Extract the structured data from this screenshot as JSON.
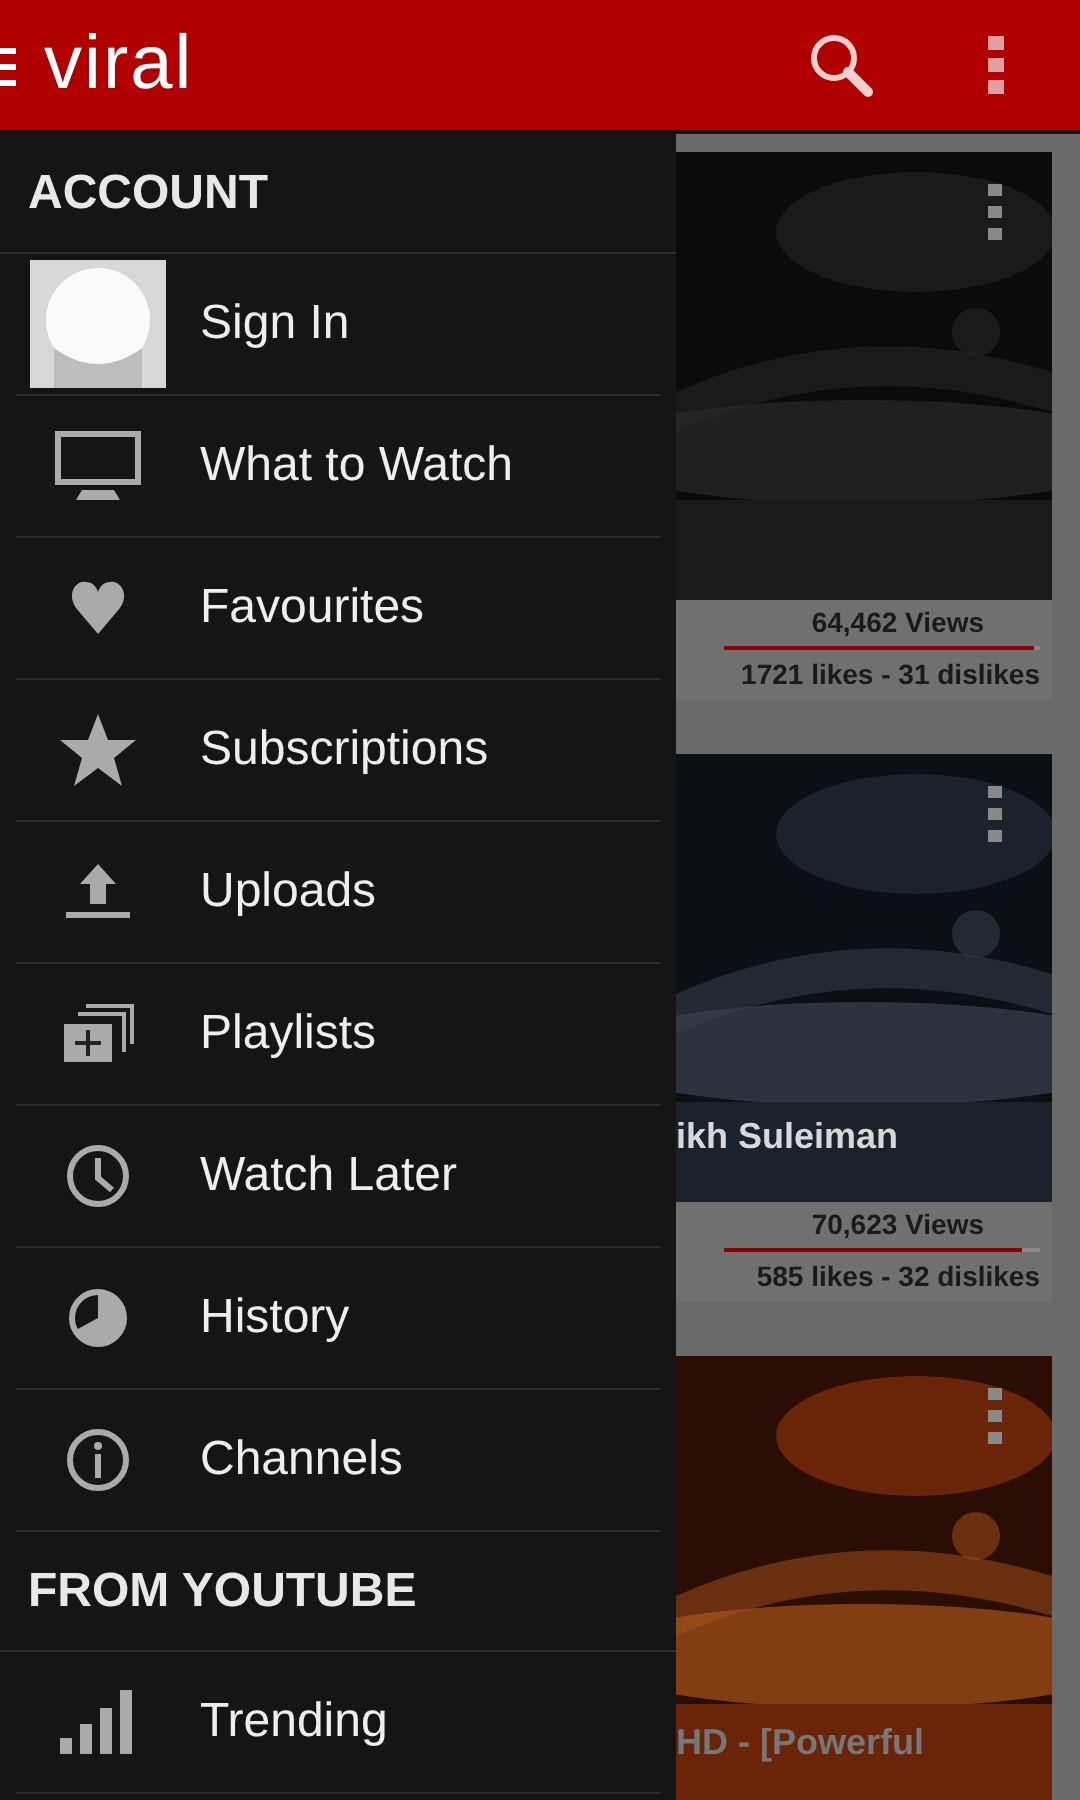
{
  "app_bar": {
    "title": "viral"
  },
  "drawer": {
    "sections": [
      {
        "heading": "ACCOUNT",
        "items": [
          {
            "label": "Sign In",
            "kind": "avatar"
          },
          {
            "label": "What to Watch",
            "kind": "monitor"
          },
          {
            "label": "Favourites",
            "kind": "heart"
          },
          {
            "label": "Subscriptions",
            "kind": "star"
          },
          {
            "label": "Uploads",
            "kind": "upload"
          },
          {
            "label": "Playlists",
            "kind": "playlists"
          },
          {
            "label": "Watch Later",
            "kind": "clock"
          },
          {
            "label": "History",
            "kind": "history"
          },
          {
            "label": "Channels",
            "kind": "info"
          }
        ]
      },
      {
        "heading": "FROM YOUTUBE",
        "items": [
          {
            "label": "Trending",
            "kind": "bars"
          }
        ]
      }
    ]
  },
  "videos": [
    {
      "kind": "dark",
      "views": "64,462 Views",
      "likes": "1721 likes - 31 dislikes",
      "level": 0.98
    },
    {
      "kind": "space",
      "title": "ikh Suleiman",
      "views": "70,623 Views",
      "likes": "585 likes - 32 dislikes",
      "level": 0.94
    },
    {
      "kind": "fire",
      "title": "HD - [Powerful"
    }
  ]
}
